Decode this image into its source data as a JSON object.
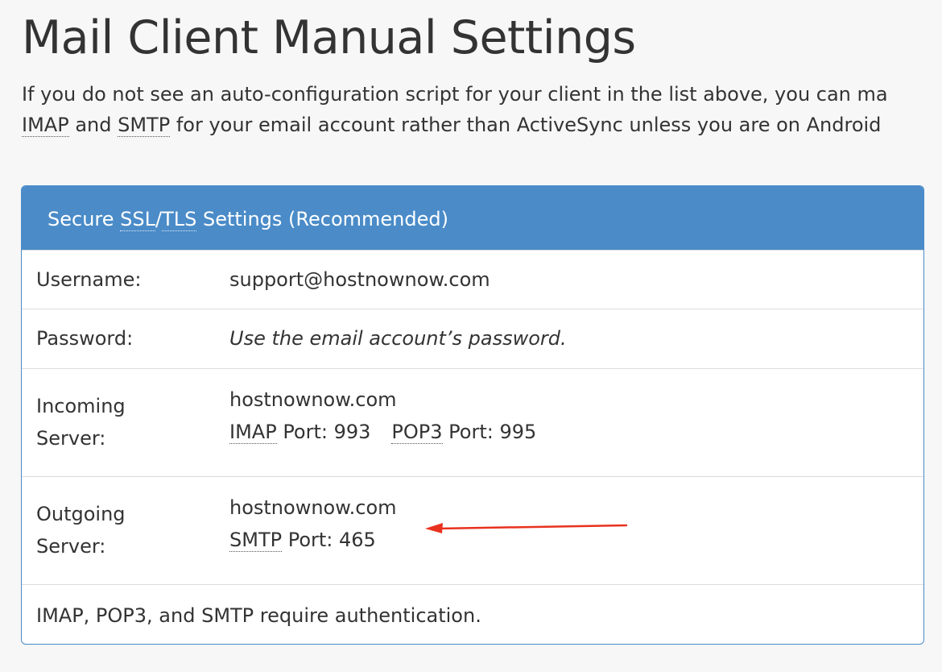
{
  "page": {
    "title": "Mail Client Manual Settings",
    "intro_line1": "If you do not see an auto-configuration script for your client in the list above, you can ma",
    "intro_line2_abbr1": "IMAP",
    "intro_line2_and": " and ",
    "intro_line2_abbr2": "SMTP",
    "intro_line2_rest": " for your email account rather than ActiveSync unless you are on Android"
  },
  "panel": {
    "header_prefix": "Secure ",
    "header_ssl": "SSL",
    "header_slash": "/",
    "header_tls": "TLS",
    "header_suffix": " Settings (Recommended)",
    "username_label": "Username:",
    "username_value": "support@hostnownow.com",
    "password_label": "Password:",
    "password_value": "Use the email account’s password.",
    "incoming_label_1": "Incoming",
    "incoming_label_2": "Server:",
    "incoming_host": "hostnownow.com",
    "incoming_imap_abbr": "IMAP",
    "incoming_imap_port": " Port: 993",
    "incoming_pop3_abbr": "POP3",
    "incoming_pop3_port": " Port: 995",
    "outgoing_label_1": "Outgoing",
    "outgoing_label_2": "Server:",
    "outgoing_host": "hostnownow.com",
    "outgoing_smtp_abbr": "SMTP",
    "outgoing_smtp_port": " Port: 465",
    "note": "IMAP, POP3, and SMTP require authentication."
  },
  "colors": {
    "panel_header": "#4a8bc8",
    "annotation_arrow": "#e8321e"
  },
  "annotation": {
    "icon": "red-arrow-icon"
  }
}
